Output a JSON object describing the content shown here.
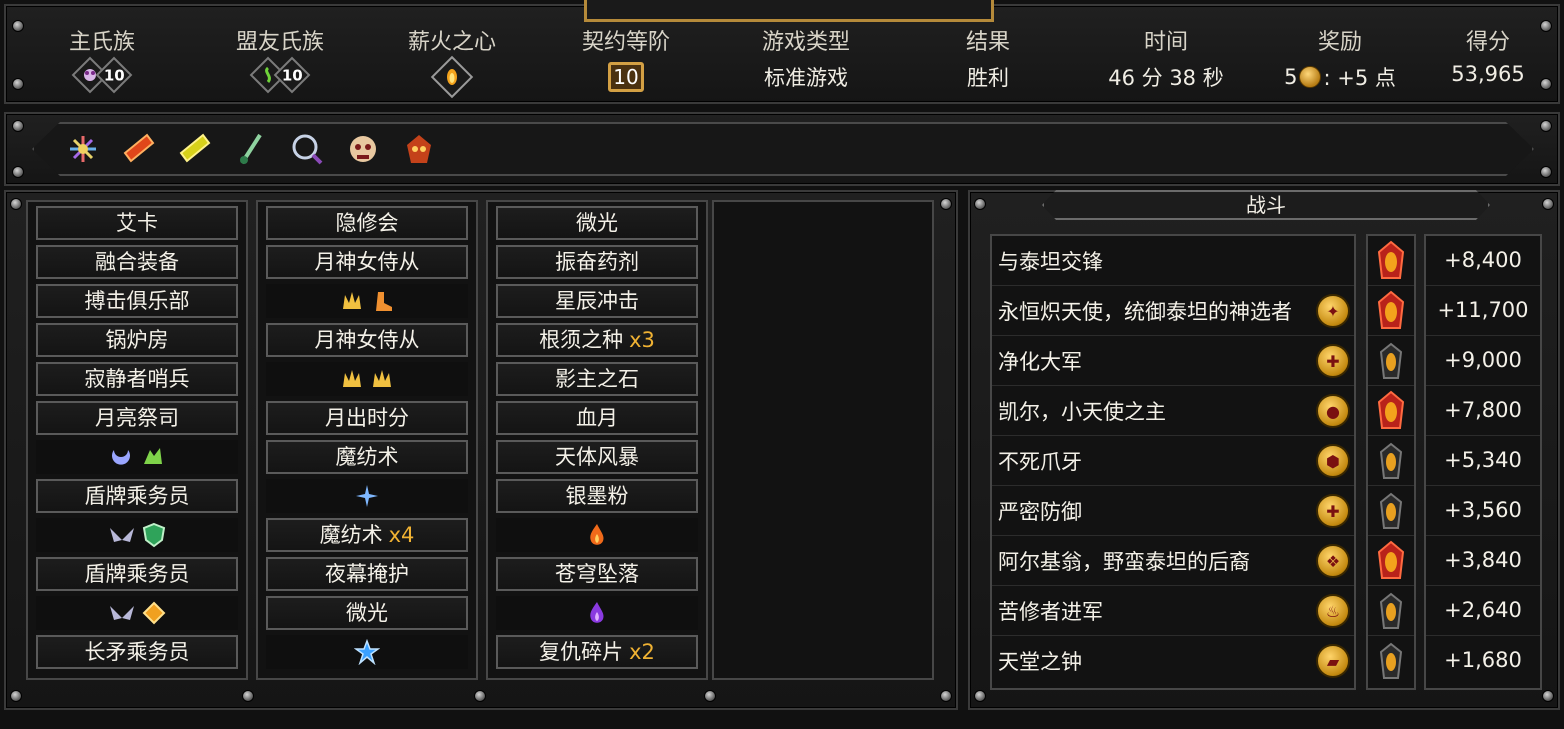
{
  "stats": {
    "main_clan": {
      "label": "主氏族",
      "level": "10"
    },
    "ally_clan": {
      "label": "盟友氏族",
      "level": "10"
    },
    "pyre_heart": {
      "label": "薪火之心"
    },
    "covenant": {
      "label": "契约等阶",
      "value": "10"
    },
    "game_type": {
      "label": "游戏类型",
      "value": "标准游戏"
    },
    "result": {
      "label": "结果",
      "value": "胜利"
    },
    "time": {
      "label": "时间",
      "value": "46 分 38 秒"
    },
    "reward": {
      "label": "奖励",
      "prefix": "5",
      "suffix": ": +5 点"
    },
    "score": {
      "label": "得分",
      "value": "53,965"
    }
  },
  "artifacts": [
    "prism-flower-icon",
    "red-crystal-icon",
    "yellow-crystal-icon",
    "green-dagger-icon",
    "ring-icon",
    "skull-orb-icon",
    "fire-mask-icon"
  ],
  "deck": {
    "col1": [
      "艾卡",
      "融合装备",
      "搏击俱乐部",
      "锅炉房",
      "寂静者哨兵",
      "月亮祭司",
      "盾牌乘务员",
      "盾牌乘务员",
      "长矛乘务员"
    ],
    "col2": [
      "隐修会",
      "月神女侍从",
      "月神女侍从",
      "月出时分",
      "魔纺术",
      "魔纺术",
      "夜幕掩护",
      "微光"
    ],
    "col2_mult": "x4",
    "col3": [
      "微光",
      "振奋药剂",
      "星辰冲击",
      "根须之种",
      "影主之石",
      "血月",
      "天体风暴",
      "银墨粉",
      "苍穹坠落",
      "复仇碎片"
    ],
    "col3_mult_a": "x3",
    "col3_mult_b": "x2"
  },
  "battle": {
    "title": "战斗",
    "rows": [
      {
        "name": "与泰坦交锋",
        "score": "+8,400",
        "icon": "none",
        "boss": true
      },
      {
        "name": "永恒炽天使，统御泰坦的神选者",
        "score": "+11,700",
        "icon": "angel-icon",
        "boss": true
      },
      {
        "name": "净化大军",
        "score": "+9,000",
        "icon": "cross-icon",
        "boss": false
      },
      {
        "name": "凯尔，小天使之主",
        "score": "+7,800",
        "icon": "pot-icon",
        "boss": true
      },
      {
        "name": "不死爪牙",
        "score": "+5,340",
        "icon": "hex-icon",
        "boss": false
      },
      {
        "name": "严密防御",
        "score": "+3,560",
        "icon": "cross-icon",
        "boss": false
      },
      {
        "name": "阿尔基翁，野蛮泰坦的后裔",
        "score": "+3,840",
        "icon": "beast-icon",
        "boss": true
      },
      {
        "name": "苦修者进军",
        "score": "+2,640",
        "icon": "flame-icon",
        "boss": false
      },
      {
        "name": "天堂之钟",
        "score": "+1,680",
        "icon": "bell-icon",
        "boss": false
      }
    ]
  },
  "colors": {
    "gold": "#f0b233",
    "panel": "#1a1a1a",
    "border": "#5a5a5a"
  }
}
